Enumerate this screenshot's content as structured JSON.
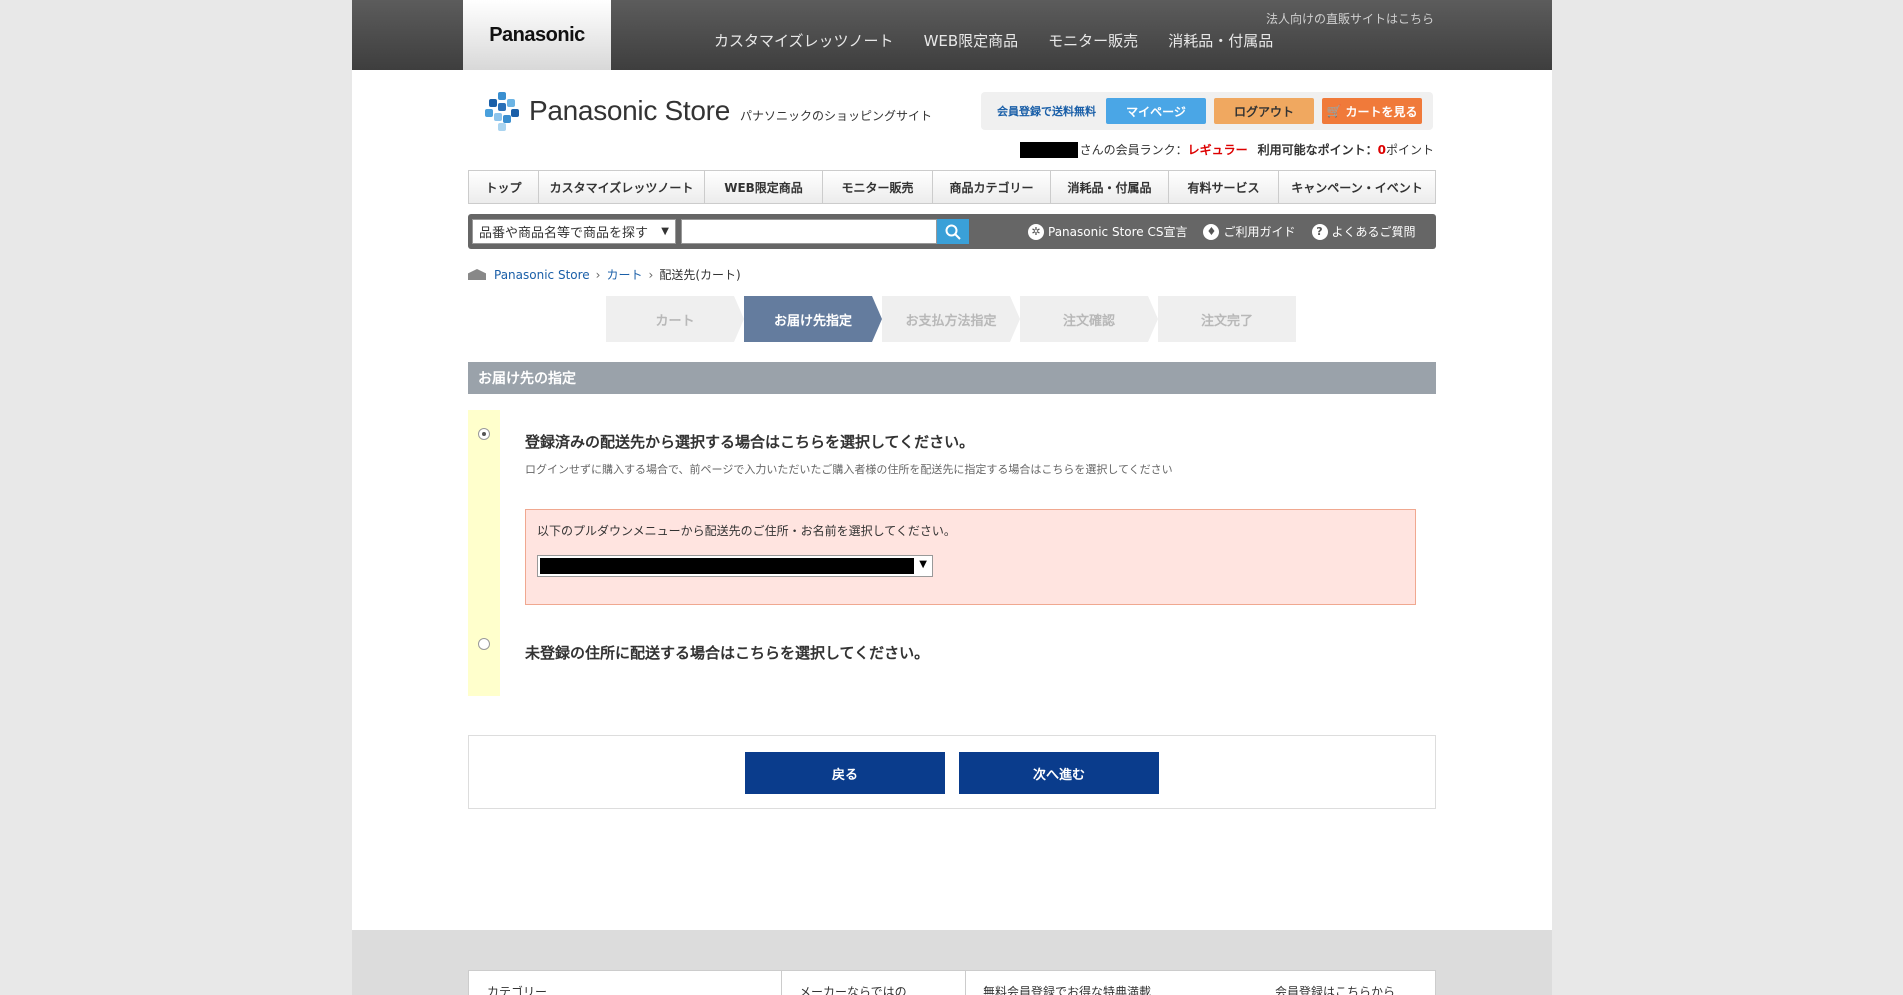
{
  "topbar": {
    "brand": "Panasonic",
    "nav": [
      "カスタマイズレッツノート",
      "WEB限定商品",
      "モニター販売",
      "消耗品・付属品"
    ],
    "corp_link": "法人向けの直販サイトはこちら"
  },
  "store": {
    "name": "Panasonic Store",
    "subtitle": "パナソニックのショッピングサイト"
  },
  "member": {
    "free_shipping": "会員登録で送料無料",
    "mypage": "マイページ",
    "logout": "ログアウト",
    "cart": "カートを見る",
    "rank_suffix": "さんの会員ランク：",
    "rank": "レギュラー",
    "points_label": "利用可能なポイント：",
    "points": "0",
    "points_unit": "ポイント"
  },
  "mainnav": [
    {
      "label": "トップ",
      "w": 70
    },
    {
      "label": "カスタマイズレッツノート",
      "w": 166
    },
    {
      "label": "WEB限定商品",
      "w": 118
    },
    {
      "label": "モニター販売",
      "w": 110
    },
    {
      "label": "商品カテゴリー",
      "w": 118
    },
    {
      "label": "消耗品・付属品",
      "w": 118
    },
    {
      "label": "有料サービス",
      "w": 110
    },
    {
      "label": "キャンペーン・イベント",
      "w": 156
    }
  ],
  "search": {
    "category": "品番や商品名等で商品を探す",
    "links": [
      {
        "icon": "panasonic-cs-icon",
        "label": "Panasonic Store CS宣言"
      },
      {
        "icon": "guide-icon",
        "label": "ご利用ガイド"
      },
      {
        "icon": "question-icon",
        "label": "よくあるご質問"
      }
    ]
  },
  "breadcrumb": [
    "Panasonic Store",
    "カート",
    "配送先(カート)"
  ],
  "steps": [
    "カート",
    "お届け先指定",
    "お支払方法指定",
    "注文確認",
    "注文完了"
  ],
  "section": {
    "title": "お届け先の指定",
    "option1_title": "登録済みの配送先から選択する場合はこちらを選択してください。",
    "option1_desc": "ログインせずに購入する場合で、前ページで入力いただいたご購入者様の住所を配送先に指定する場合はこちらを選択してください",
    "select_label": "以下のプルダウンメニューから配送先のご住所・お名前を選択してください。",
    "option2_title": "未登録の住所に配送する場合はこちらを選択してください。"
  },
  "buttons": {
    "back": "戻る",
    "next": "次へ進む"
  },
  "footer": {
    "col1": "カテゴリー",
    "col2": "メーカーならではの",
    "col3": "無料会員登録でお得な特典満載",
    "col4": "会員登録はこちらから"
  },
  "colors": {
    "active_step": "#647c9e",
    "nav_button": "#0a3c8c",
    "rank": "#dd0000"
  }
}
